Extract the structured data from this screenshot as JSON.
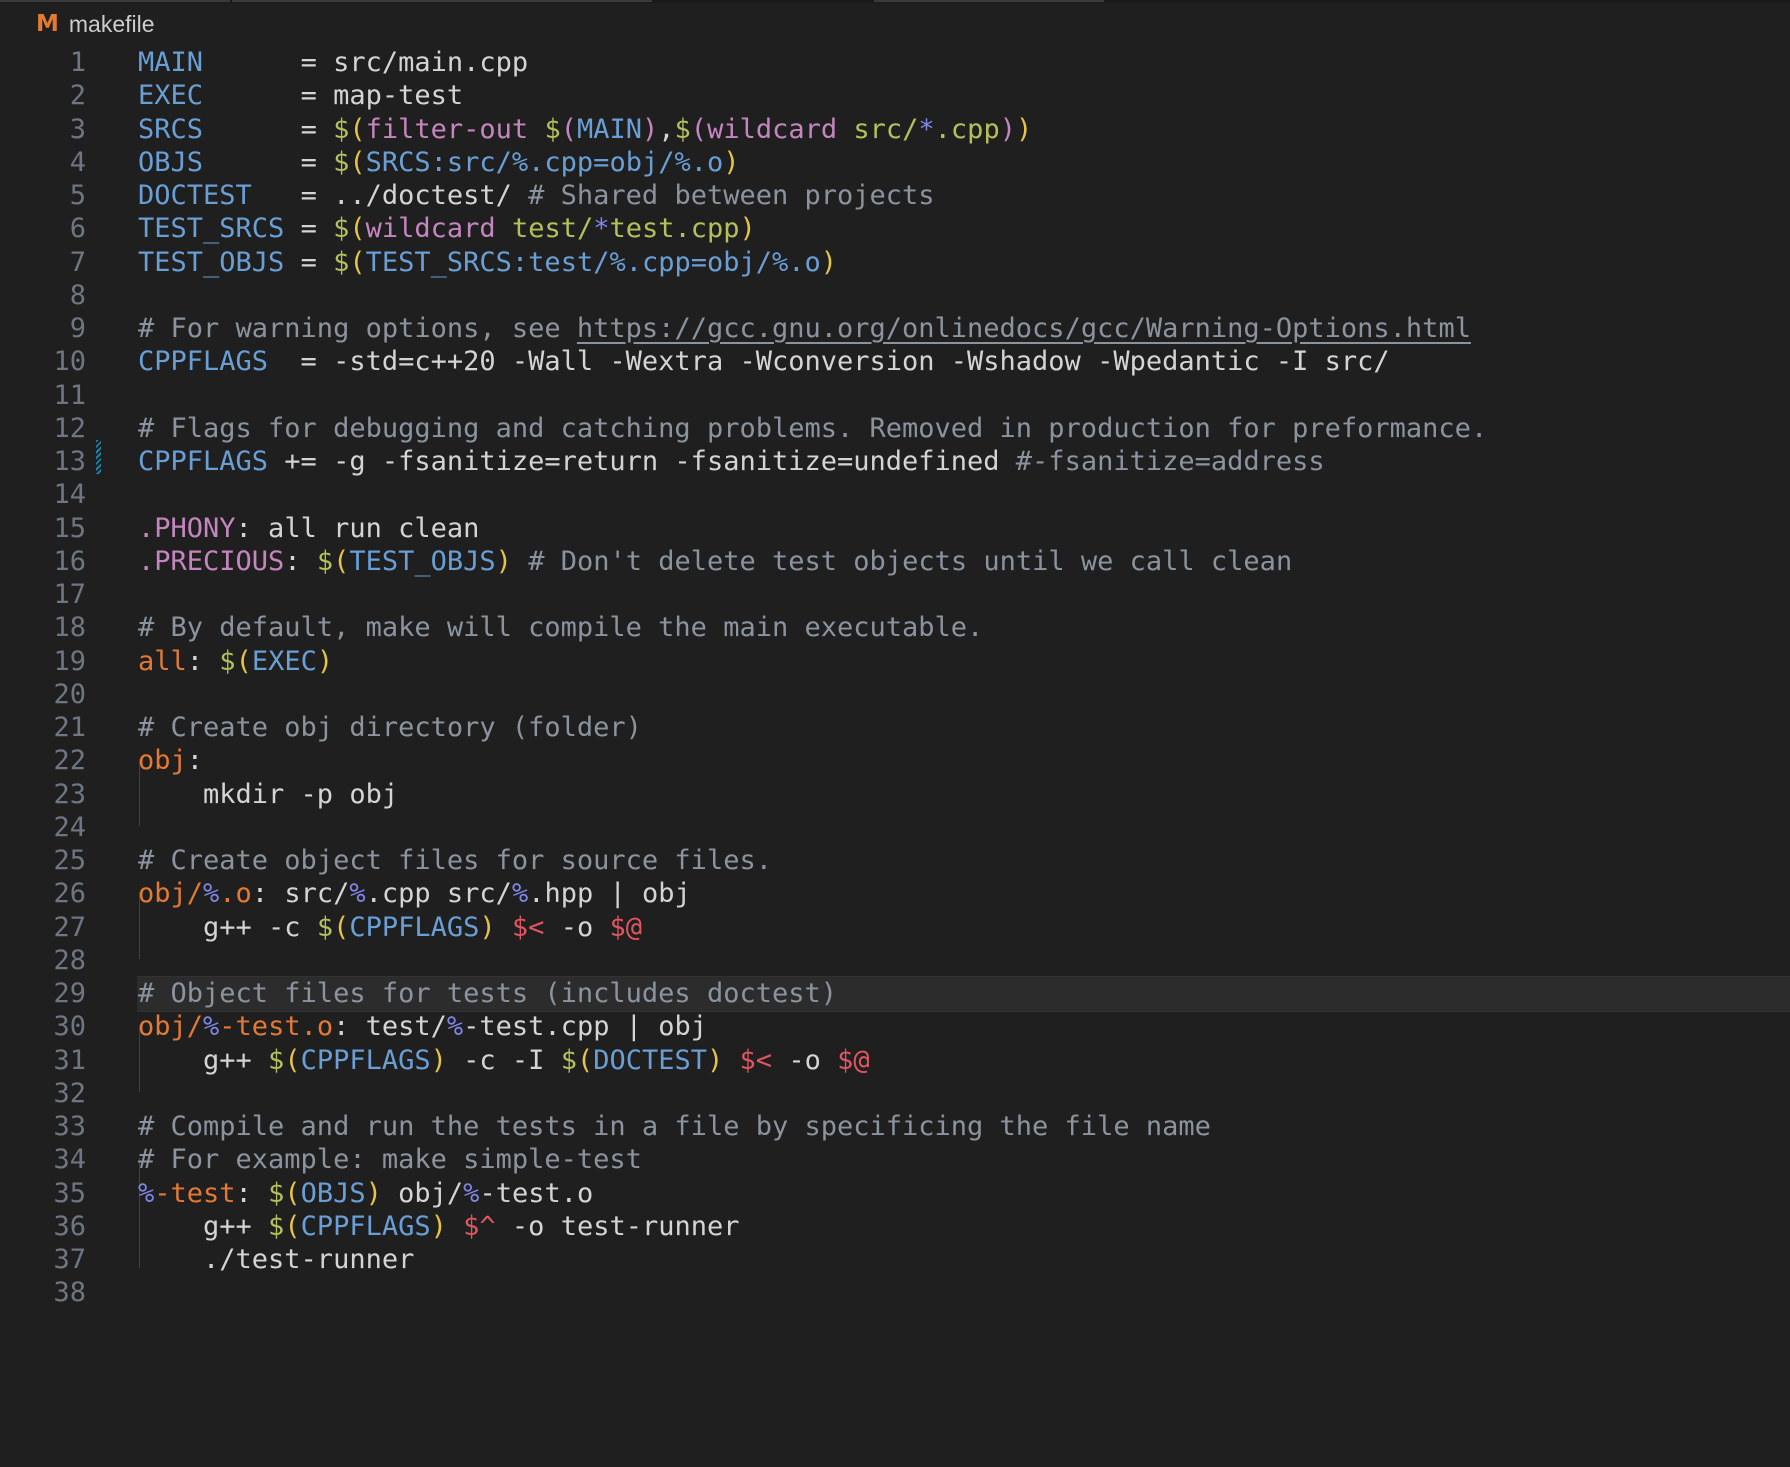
{
  "editor": {
    "file_name": "makefile",
    "file_icon": "M",
    "icon_color": "#e37933",
    "background": "#1f1f1f"
  },
  "lines": [
    [
      [
        "var",
        "MAIN"
      ],
      [
        "wt",
        "      = src/main.cpp"
      ]
    ],
    [
      [
        "var",
        "EXEC"
      ],
      [
        "wt",
        "      = map-test"
      ]
    ],
    [
      [
        "var",
        "SRCS"
      ],
      [
        "wt",
        "      = "
      ],
      [
        "dol",
        "$"
      ],
      [
        "par",
        "("
      ],
      [
        "fn",
        "filter-out"
      ],
      [
        "wt",
        " "
      ],
      [
        "dol",
        "$"
      ],
      [
        "fn",
        "("
      ],
      [
        "var",
        "MAIN"
      ],
      [
        "fn",
        ")"
      ],
      [
        "wt",
        ","
      ],
      [
        "dol",
        "$"
      ],
      [
        "fn",
        "("
      ],
      [
        "fn",
        "wildcard"
      ],
      [
        "wt",
        " "
      ],
      [
        "grn",
        "src/"
      ],
      [
        "pct",
        "*"
      ],
      [
        "grn",
        ".cpp"
      ],
      [
        "fn",
        ")"
      ],
      [
        "par",
        ")"
      ]
    ],
    [
      [
        "var",
        "OBJS"
      ],
      [
        "wt",
        "      = "
      ],
      [
        "dol",
        "$"
      ],
      [
        "par",
        "("
      ],
      [
        "var",
        "SRCS:src/%.cpp=obj/%.o"
      ],
      [
        "par",
        ")"
      ]
    ],
    [
      [
        "var",
        "DOCTEST"
      ],
      [
        "wt",
        "   = ../doctest/ "
      ],
      [
        "cmt",
        "# Shared between projects"
      ]
    ],
    [
      [
        "var",
        "TEST_SRCS"
      ],
      [
        "wt",
        " = "
      ],
      [
        "dol",
        "$"
      ],
      [
        "par",
        "("
      ],
      [
        "fn",
        "wildcard"
      ],
      [
        "wt",
        " "
      ],
      [
        "grn",
        "test/"
      ],
      [
        "pct",
        "*"
      ],
      [
        "grn",
        "test.cpp"
      ],
      [
        "par",
        ")"
      ]
    ],
    [
      [
        "var",
        "TEST_OBJS"
      ],
      [
        "wt",
        " = "
      ],
      [
        "dol",
        "$"
      ],
      [
        "par",
        "("
      ],
      [
        "var",
        "TEST_SRCS:test/%.cpp=obj/%.o"
      ],
      [
        "par",
        ")"
      ]
    ],
    [],
    [
      [
        "cmt",
        "# For warning options, see "
      ],
      [
        "lnk",
        "https://gcc.gnu.org/onlinedocs/gcc/Warning-Options.html"
      ]
    ],
    [
      [
        "var",
        "CPPFLAGS"
      ],
      [
        "wt",
        "  = -std=c++20 -Wall -Wextra -Wconversion -Wshadow -Wpedantic -I src/"
      ]
    ],
    [],
    [
      [
        "cmt",
        "# Flags for debugging and catching problems. Removed in production for preformance."
      ]
    ],
    [
      [
        "var",
        "CPPFLAGS"
      ],
      [
        "wt",
        " += -g -fsanitize=return -fsanitize=undefined "
      ],
      [
        "cmt",
        "#-fsanitize=address"
      ]
    ],
    [],
    [
      [
        "ph",
        ".PHONY"
      ],
      [
        "wt",
        ": all run clean"
      ]
    ],
    [
      [
        "ph",
        ".PRECIOUS"
      ],
      [
        "wt",
        ": "
      ],
      [
        "dol",
        "$"
      ],
      [
        "par",
        "("
      ],
      [
        "var",
        "TEST_OBJS"
      ],
      [
        "par",
        ")"
      ],
      [
        "cmt",
        " # Don't delete test objects until we call clean"
      ]
    ],
    [],
    [
      [
        "cmt",
        "# By default, make will compile the main executable."
      ]
    ],
    [
      [
        "tgt",
        "all"
      ],
      [
        "wt",
        ": "
      ],
      [
        "dol",
        "$"
      ],
      [
        "par",
        "("
      ],
      [
        "var",
        "EXEC"
      ],
      [
        "par",
        ")"
      ]
    ],
    [],
    [
      [
        "cmt",
        "# Create obj directory (folder)"
      ]
    ],
    [
      [
        "tgt",
        "obj"
      ],
      [
        "wt",
        ":"
      ]
    ],
    [
      [
        "wt",
        "    mkdir -p obj"
      ]
    ],
    [],
    [
      [
        "cmt",
        "# Create object files for source files."
      ]
    ],
    [
      [
        "tgt",
        "obj/"
      ],
      [
        "pct",
        "%"
      ],
      [
        "tgt",
        ".o"
      ],
      [
        "wt",
        ": src/"
      ],
      [
        "pct",
        "%"
      ],
      [
        "wt",
        ".cpp src/"
      ],
      [
        "pct",
        "%"
      ],
      [
        "wt",
        ".hpp | obj"
      ]
    ],
    [
      [
        "wt",
        "    g++ -c "
      ],
      [
        "dol",
        "$"
      ],
      [
        "par",
        "("
      ],
      [
        "var",
        "CPPFLAGS"
      ],
      [
        "par",
        ")"
      ],
      [
        "wt",
        " "
      ],
      [
        "auto",
        "$<"
      ],
      [
        "wt",
        " -o "
      ],
      [
        "auto",
        "$@"
      ]
    ],
    [],
    [
      [
        "cmt",
        "# Object files for tests (includes doctest)"
      ]
    ],
    [
      [
        "tgt",
        "obj/"
      ],
      [
        "pct",
        "%"
      ],
      [
        "tgt",
        "-test.o"
      ],
      [
        "wt",
        ": test/"
      ],
      [
        "pct",
        "%"
      ],
      [
        "wt",
        "-test.cpp | obj"
      ]
    ],
    [
      [
        "wt",
        "    g++ "
      ],
      [
        "dol",
        "$"
      ],
      [
        "par",
        "("
      ],
      [
        "var",
        "CPPFLAGS"
      ],
      [
        "par",
        ")"
      ],
      [
        "wt",
        " -c -I "
      ],
      [
        "dol",
        "$"
      ],
      [
        "par",
        "("
      ],
      [
        "var",
        "DOCTEST"
      ],
      [
        "par",
        ")"
      ],
      [
        "wt",
        " "
      ],
      [
        "auto",
        "$<"
      ],
      [
        "wt",
        " -o "
      ],
      [
        "auto",
        "$@"
      ]
    ],
    [],
    [
      [
        "cmt",
        "# Compile and run the tests in a file by specificing the file name"
      ]
    ],
    [
      [
        "cmt",
        "# For example: make simple-test"
      ]
    ],
    [
      [
        "pct",
        "%"
      ],
      [
        "tgt",
        "-test"
      ],
      [
        "wt",
        ": "
      ],
      [
        "dol",
        "$"
      ],
      [
        "par",
        "("
      ],
      [
        "var",
        "OBJS"
      ],
      [
        "par",
        ")"
      ],
      [
        "wt",
        " obj/"
      ],
      [
        "pct",
        "%"
      ],
      [
        "wt",
        "-test.o"
      ]
    ],
    [
      [
        "wt",
        "    g++ "
      ],
      [
        "dol",
        "$"
      ],
      [
        "par",
        "("
      ],
      [
        "var",
        "CPPFLAGS"
      ],
      [
        "par",
        ")"
      ],
      [
        "wt",
        " "
      ],
      [
        "auto",
        "$^"
      ],
      [
        "wt",
        " -o test-runner"
      ]
    ],
    [
      [
        "wt",
        "    ./test-runner"
      ]
    ],
    []
  ],
  "line_numbers": [
    "1",
    "2",
    "3",
    "4",
    "5",
    "6",
    "7",
    "8",
    "9",
    "10",
    "11",
    "12",
    "13",
    "14",
    "15",
    "16",
    "17",
    "18",
    "19",
    "20",
    "21",
    "22",
    "23",
    "24",
    "25",
    "26",
    "27",
    "28",
    "29",
    "30",
    "31",
    "32",
    "33",
    "34",
    "35",
    "36",
    "37",
    "38"
  ],
  "highlighted_line": 29,
  "modified_line": 13
}
